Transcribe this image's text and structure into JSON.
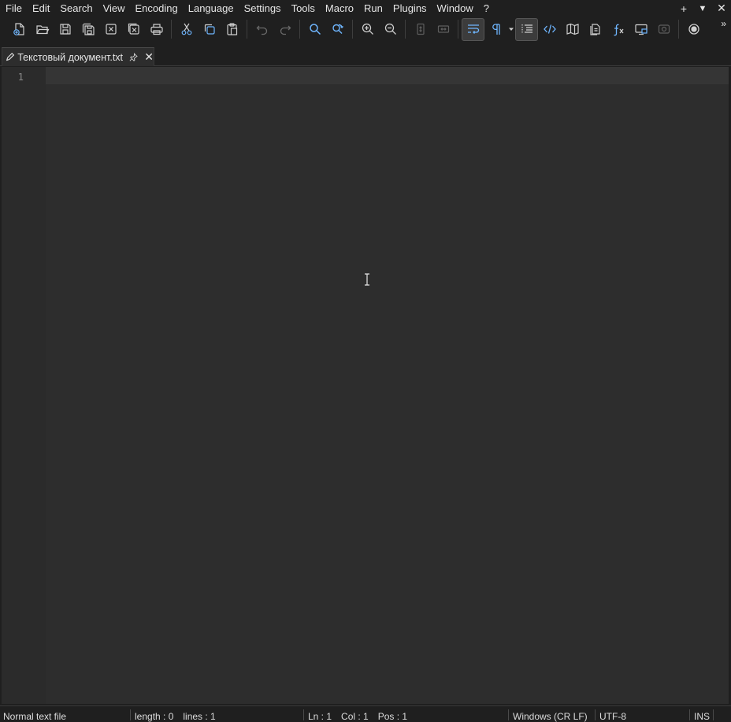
{
  "menu": {
    "items": [
      "File",
      "Edit",
      "Search",
      "View",
      "Encoding",
      "Language",
      "Settings",
      "Tools",
      "Macro",
      "Run",
      "Plugins",
      "Window",
      "?"
    ],
    "right": {
      "add": "+",
      "dropdown": "▼",
      "close": "✕"
    }
  },
  "toolbar": {
    "overflow": "»",
    "accent": "#6fb6ff",
    "buttons": [
      "new-file-icon",
      "open-file-icon",
      "save-icon",
      "save-all-icon",
      "close-icon",
      "close-all-icon",
      "print-icon",
      "cut-icon",
      "copy-icon",
      "paste-icon",
      "undo-icon",
      "redo-icon",
      "find-icon",
      "replace-icon",
      "zoom-in-icon",
      "zoom-out-icon",
      "sync-vertical-icon",
      "sync-horizontal-icon",
      "word-wrap-icon",
      "show-all-characters-icon",
      "indent-guide-icon",
      "xml-tag-icon",
      "document-map-icon",
      "document-list-icon",
      "function-list-icon",
      "folder-workspace-icon",
      "monitoring-icon",
      "record-macro-icon"
    ]
  },
  "tabs": [
    {
      "title": "Текстовый документ.txt",
      "modified": true
    }
  ],
  "editor": {
    "line_numbers": [
      "1"
    ],
    "content": "",
    "colors": {
      "background": "#2d2d2d",
      "current_line": "#353535",
      "gutter": "#2b2b2b"
    }
  },
  "status": {
    "file_type": "Normal text file",
    "length": "length : 0",
    "lines": "lines : 1",
    "ln": "Ln : 1",
    "col": "Col : 1",
    "pos": "Pos : 1",
    "eol": "Windows (CR LF)",
    "encoding": "UTF-8",
    "mode": "INS"
  }
}
